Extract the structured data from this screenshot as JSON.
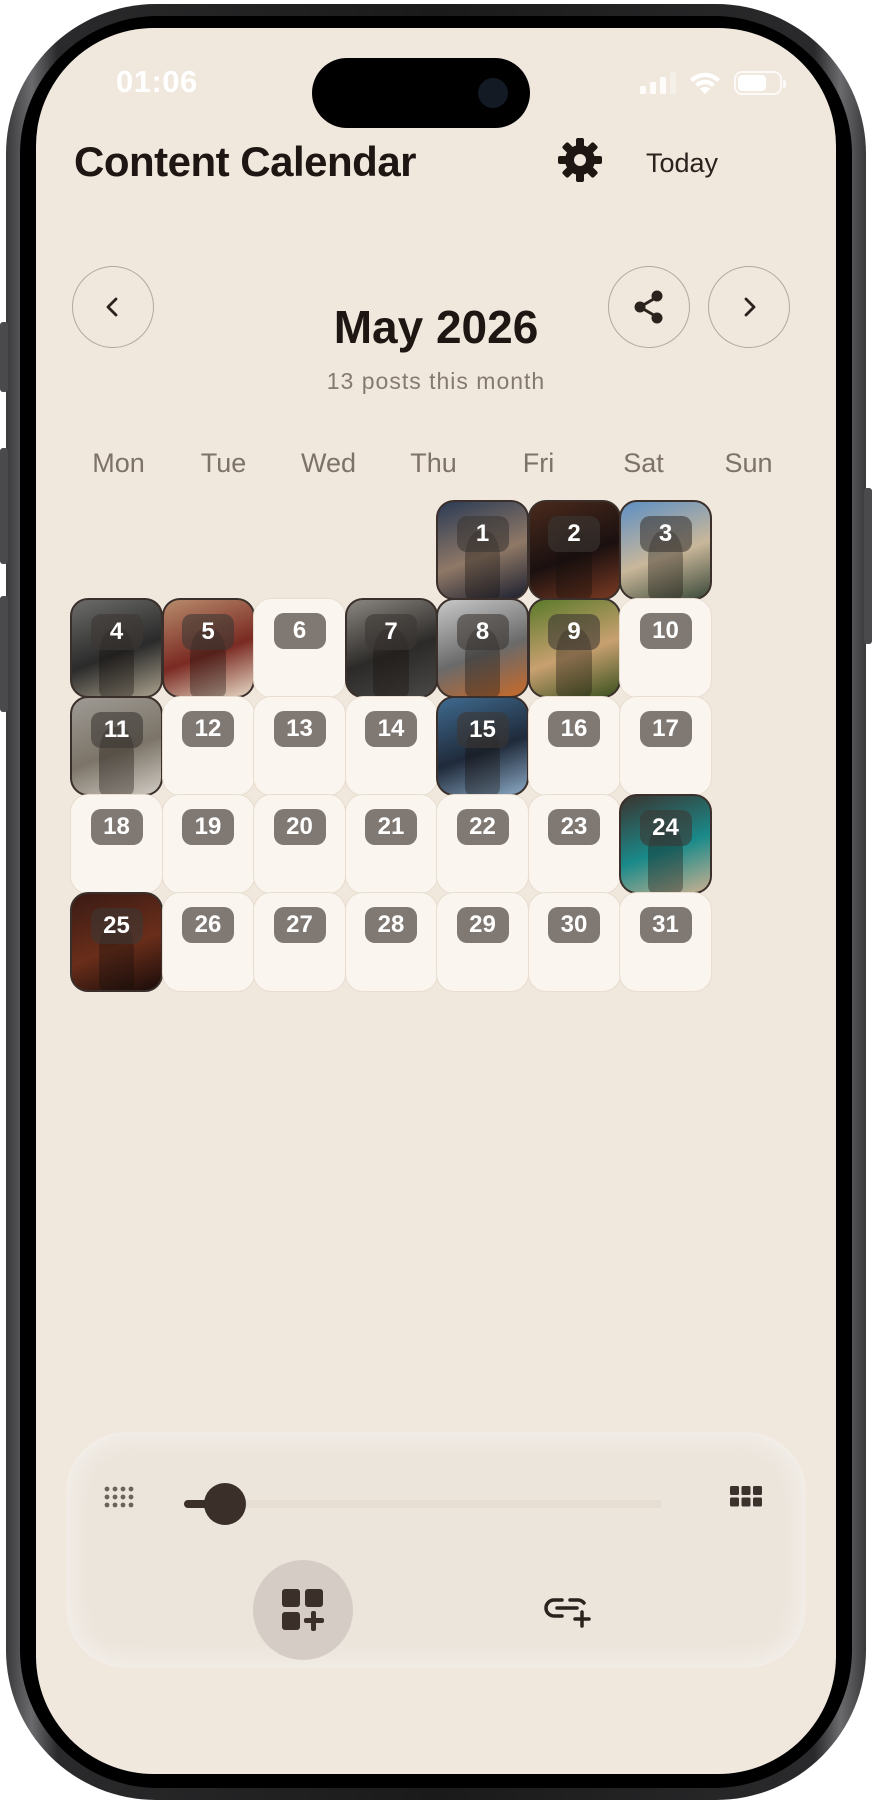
{
  "status_bar": {
    "time": "01:06"
  },
  "header": {
    "title": "Content Calendar",
    "today_label": "Today",
    "icons": {
      "settings": "gear-icon"
    }
  },
  "month": {
    "title": "May 2026",
    "subtitle": "13 posts this month",
    "icons": {
      "prev": "chevron-left-icon",
      "next": "chevron-right-icon",
      "share": "share-icon"
    }
  },
  "weekdays": [
    "Mon",
    "Tue",
    "Wed",
    "Thu",
    "Fri",
    "Sat",
    "Sun"
  ],
  "calendar": {
    "first_weekday_index": 4,
    "days": [
      {
        "n": "1",
        "post": true
      },
      {
        "n": "2",
        "post": true
      },
      {
        "n": "3",
        "post": true
      },
      {
        "n": "4",
        "post": true
      },
      {
        "n": "5",
        "post": true
      },
      {
        "n": "6",
        "post": false
      },
      {
        "n": "7",
        "post": true
      },
      {
        "n": "8",
        "post": true
      },
      {
        "n": "9",
        "post": true
      },
      {
        "n": "10",
        "post": false
      },
      {
        "n": "11",
        "post": true
      },
      {
        "n": "12",
        "post": false
      },
      {
        "n": "13",
        "post": false
      },
      {
        "n": "14",
        "post": false
      },
      {
        "n": "15",
        "post": true
      },
      {
        "n": "16",
        "post": false
      },
      {
        "n": "17",
        "post": false
      },
      {
        "n": "18",
        "post": false
      },
      {
        "n": "19",
        "post": false
      },
      {
        "n": "20",
        "post": false
      },
      {
        "n": "21",
        "post": false
      },
      {
        "n": "22",
        "post": false
      },
      {
        "n": "23",
        "post": false
      },
      {
        "n": "24",
        "post": true
      },
      {
        "n": "25",
        "post": true
      },
      {
        "n": "26",
        "post": false
      },
      {
        "n": "27",
        "post": false
      },
      {
        "n": "28",
        "post": false
      },
      {
        "n": "29",
        "post": false
      },
      {
        "n": "30",
        "post": false
      },
      {
        "n": "31",
        "post": false
      }
    ]
  },
  "bottom_panel": {
    "grid_size_slider": {
      "value": 0.05
    },
    "icons": {
      "small_grid": "small-grid-icon",
      "large_grid": "large-grid-icon",
      "add_grid": "add-grid-icon",
      "add_link": "add-link-icon"
    }
  }
}
